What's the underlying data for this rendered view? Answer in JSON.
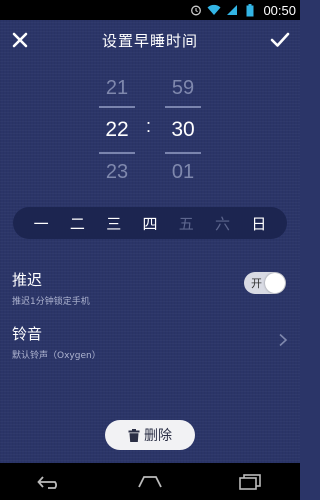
{
  "status_bar": {
    "time": "00:50",
    "icons": [
      "alarm-icon",
      "wifi-icon",
      "signal-icon",
      "battery-icon"
    ]
  },
  "header": {
    "title": "设置早睡时间",
    "close_icon": "close-icon",
    "confirm_icon": "check-icon"
  },
  "time_picker": {
    "hours": [
      "21",
      "22",
      "23"
    ],
    "minutes": [
      "59",
      "30",
      "01"
    ],
    "separator": ":"
  },
  "weekdays": [
    {
      "label": "一",
      "active": true
    },
    {
      "label": "二",
      "active": true
    },
    {
      "label": "三",
      "active": true
    },
    {
      "label": "四",
      "active": true
    },
    {
      "label": "五",
      "active": false
    },
    {
      "label": "六",
      "active": false
    },
    {
      "label": "日",
      "active": true
    }
  ],
  "snooze": {
    "label": "推迟",
    "description": "推迟1分钟锁定手机",
    "toggle_label": "开",
    "enabled": true
  },
  "ringtone": {
    "label": "铃音",
    "description": "默认铃声（Oxygen）"
  },
  "delete_button": {
    "label": "删除",
    "icon": "trash-icon"
  },
  "nav_bar": {
    "icons": [
      "back-icon",
      "home-icon",
      "recent-apps-icon"
    ]
  },
  "colors": {
    "background": "#2b3568",
    "weekday_bar": "#1c2550",
    "inactive_day": "#5d668e"
  }
}
